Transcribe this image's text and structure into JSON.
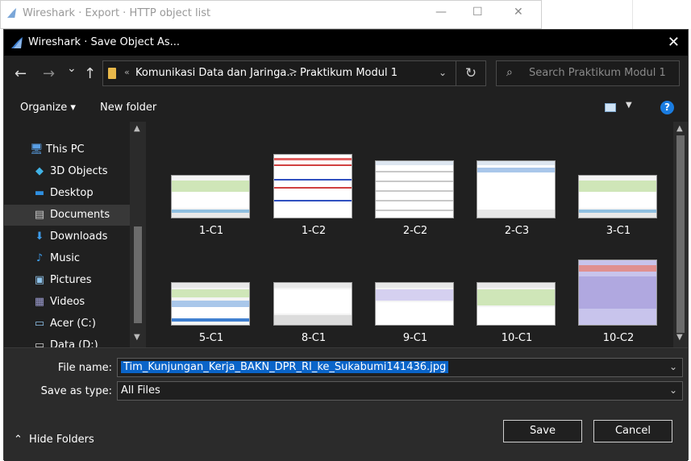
{
  "background_window": {
    "title": "Wireshark · Export · HTTP object list",
    "minimize_glyph": "—",
    "maximize_glyph": "☐",
    "close_glyph": "✕"
  },
  "dialog": {
    "title": "Wireshark · Save Object As...",
    "close_glyph": "✕"
  },
  "navigation": {
    "back_glyph": "←",
    "forward_glyph": "→",
    "recent_glyph": "⌄",
    "up_glyph": "↑",
    "address": {
      "overflow_glyph": "«",
      "crumbs": [
        "Komunikasi Data dan Jaringa...",
        "Praktikum Modul 1"
      ],
      "separator": ">",
      "dropdown_glyph": "⌄",
      "refresh_glyph": "↻"
    },
    "search": {
      "placeholder": "Search Praktikum Modul 1",
      "icon": "search-icon"
    }
  },
  "toolbar": {
    "organize_label": "Organize ▾",
    "new_folder_label": "New folder",
    "view_dropdown_glyph": "▼",
    "help_glyph": "?"
  },
  "nav_pane": {
    "items": [
      {
        "label": "This PC",
        "icon": "computer-icon",
        "glyph": "🖥",
        "color": "#5aa0e6"
      },
      {
        "label": "3D Objects",
        "icon": "cube-icon",
        "glyph": "◆",
        "color": "#41b3e6"
      },
      {
        "label": "Desktop",
        "icon": "desktop-icon",
        "glyph": "▬",
        "color": "#2f8fe0"
      },
      {
        "label": "Documents",
        "icon": "documents-icon",
        "glyph": "▤",
        "color": "#c9c9c9",
        "selected": true
      },
      {
        "label": "Downloads",
        "icon": "download-icon",
        "glyph": "⬇",
        "color": "#3d9be9"
      },
      {
        "label": "Music",
        "icon": "music-icon",
        "glyph": "♪",
        "color": "#3d9be9"
      },
      {
        "label": "Pictures",
        "icon": "pictures-icon",
        "glyph": "▣",
        "color": "#8fc3ea"
      },
      {
        "label": "Videos",
        "icon": "videos-icon",
        "glyph": "▦",
        "color": "#9b9bcf"
      },
      {
        "label": "Acer (C:)",
        "icon": "drive-icon",
        "glyph": "▭",
        "color": "#8fc3ea"
      },
      {
        "label": "Data (D:)",
        "icon": "drive-icon",
        "glyph": "▭",
        "color": "#cfcfcf"
      }
    ],
    "scroll_up_glyph": "▲",
    "scroll_down_glyph": "▼"
  },
  "files": [
    {
      "name": "1-C1",
      "thumb": "wireshark-green"
    },
    {
      "name": "1-C2",
      "thumb": "text-red"
    },
    {
      "name": "2-C2",
      "thumb": "list-white"
    },
    {
      "name": "2-C3",
      "thumb": "dialog-white"
    },
    {
      "name": "3-C1",
      "thumb": "wireshark-green"
    },
    {
      "name": "5-C1",
      "thumb": "wireshark-blue"
    },
    {
      "name": "8-C1",
      "thumb": "wireshark-plain"
    },
    {
      "name": "9-C1",
      "thumb": "wireshark-purple"
    },
    {
      "name": "10-C1",
      "thumb": "wireshark-green2"
    },
    {
      "name": "10-C2",
      "thumb": "text-purple"
    }
  ],
  "form": {
    "file_name_label": "File name:",
    "file_name_value": "Tim_Kunjungan_Kerja_BAKN_DPR_RI_ke_Sukabumi141436.jpg",
    "save_as_type_label": "Save as type:",
    "save_as_type_value": "All Files",
    "dropdown_glyph": "⌄",
    "hide_folders_label": "Hide Folders",
    "hide_folders_glyph": "⌃",
    "save_label": "Save",
    "cancel_label": "Cancel"
  },
  "colors": {
    "dialog_bg": "#202020",
    "titlebar_bg": "#000000",
    "selection": "#0a64c8",
    "help_blue": "#1a7ce0"
  }
}
